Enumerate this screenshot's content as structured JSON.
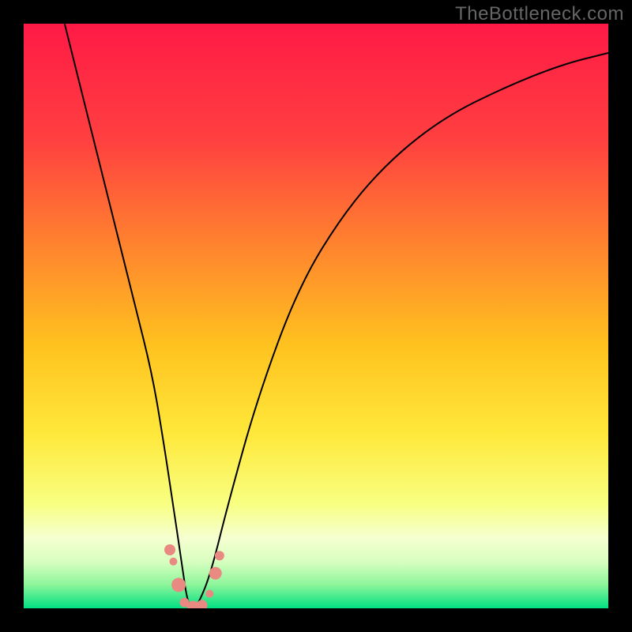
{
  "watermark": "TheBottleneck.com",
  "chart_data": {
    "type": "line",
    "title": "",
    "xlabel": "",
    "ylabel": "",
    "xlim": [
      0,
      100
    ],
    "ylim": [
      0,
      100
    ],
    "background_gradient": {
      "type": "vertical",
      "stops": [
        {
          "pos": 0.0,
          "color": "#ff1a46"
        },
        {
          "pos": 0.2,
          "color": "#ff4040"
        },
        {
          "pos": 0.4,
          "color": "#ff8b2c"
        },
        {
          "pos": 0.55,
          "color": "#ffc21f"
        },
        {
          "pos": 0.7,
          "color": "#ffe83a"
        },
        {
          "pos": 0.82,
          "color": "#f8ff80"
        },
        {
          "pos": 0.88,
          "color": "#f5ffd0"
        },
        {
          "pos": 0.92,
          "color": "#d8ffc0"
        },
        {
          "pos": 0.96,
          "color": "#8cf59a"
        },
        {
          "pos": 1.0,
          "color": "#00e082"
        }
      ]
    },
    "series": [
      {
        "name": "bottleneck-curve",
        "x": [
          7,
          10,
          13,
          16,
          19,
          22,
          24,
          25.5,
          27,
          28,
          29,
          30,
          32,
          35,
          40,
          47,
          55,
          63,
          72,
          82,
          92,
          100
        ],
        "y": [
          100,
          88,
          76,
          64,
          52,
          40,
          28,
          18,
          8,
          1,
          0,
          1,
          6,
          18,
          36,
          55,
          68,
          77,
          84,
          89,
          93,
          95
        ],
        "stroke": "#000000",
        "stroke_width": 2
      }
    ],
    "markers": [
      {
        "x": 25.0,
        "y": 10.0,
        "r": 7,
        "color": "#e88a82"
      },
      {
        "x": 25.6,
        "y": 8.0,
        "r": 5,
        "color": "#e88a82"
      },
      {
        "x": 26.5,
        "y": 4.0,
        "r": 9,
        "color": "#e88a82"
      },
      {
        "x": 27.5,
        "y": 1.0,
        "r": 6,
        "color": "#e88a82"
      },
      {
        "x": 29.0,
        "y": 0.2,
        "r": 8,
        "color": "#e88a82"
      },
      {
        "x": 30.5,
        "y": 0.5,
        "r": 7,
        "color": "#e88a82"
      },
      {
        "x": 31.8,
        "y": 2.5,
        "r": 5,
        "color": "#e88a82"
      },
      {
        "x": 32.8,
        "y": 6.0,
        "r": 8,
        "color": "#e88a82"
      },
      {
        "x": 33.5,
        "y": 9.0,
        "r": 6,
        "color": "#e88a82"
      }
    ]
  }
}
